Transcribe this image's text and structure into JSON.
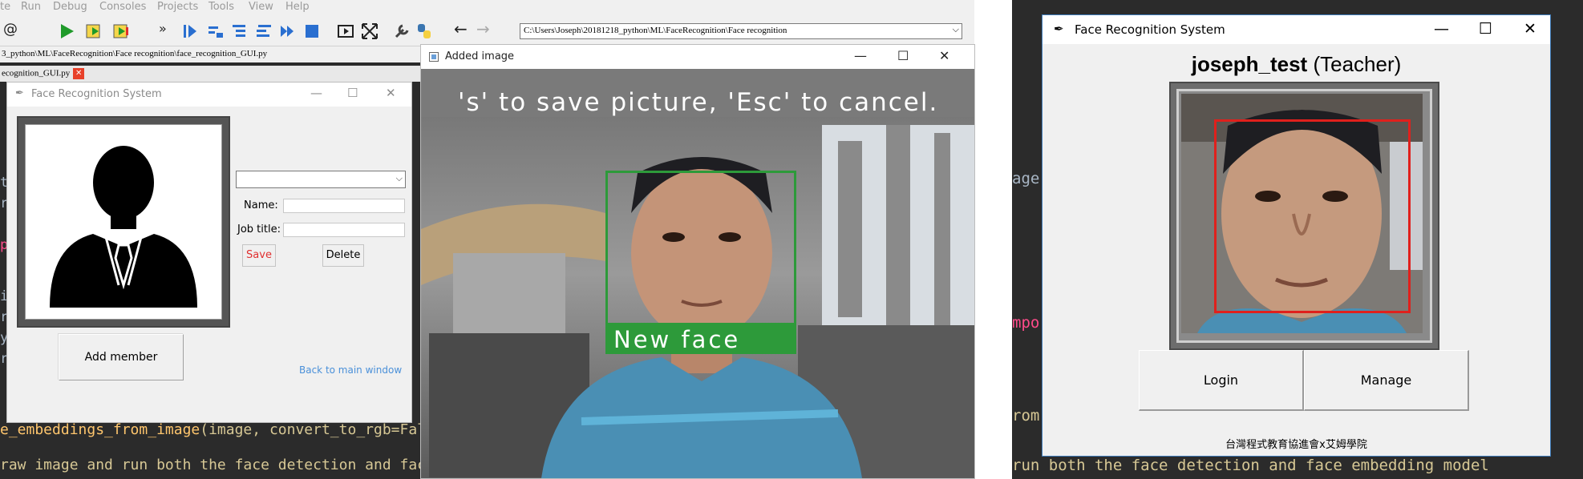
{
  "ide": {
    "menus": [
      "te",
      "Run",
      "Debug",
      "Consoles",
      "Projects",
      "Tools",
      "View",
      "Help"
    ],
    "path": "C:\\Users\\Joseph\\20181218_python\\ML\\FaceRecognition\\Face recognition",
    "file_path": "3_python\\ML\\FaceRecognition\\Face recognition\\face_recognition_GUI.py",
    "tab_label": "ecognition_GUI.py",
    "code_line_1_name": "e_embeddings_from_image",
    "code_line_1_rest": "(image, convert_to_rgb=Fals",
    "code_line_2": "raw image and run both the face detection and face",
    "right_code_line": "run both the face detection and face embedding model",
    "right_fragments": [
      "age",
      "mpo",
      "rom"
    ]
  },
  "small_window": {
    "title": "Face Recognition System",
    "name_label": "Name:",
    "job_label": "Job title:",
    "save_label": "Save",
    "delete_label": "Delete",
    "add_label": "Add member",
    "back_label": "Back to main window",
    "combo_value": "",
    "name_value": "",
    "job_value": ""
  },
  "camera_window": {
    "title": "Added image",
    "overlay_text": "'s' to save picture, 'Esc' to cancel.",
    "face_label": "New face",
    "box_color": "#2d9a3a"
  },
  "main_window": {
    "title": "Face Recognition System",
    "user_name": "joseph_test",
    "user_role": "(Teacher)",
    "login_label": "Login",
    "manage_label": "Manage",
    "footer": "台灣程式教育協進會x艾姆學院",
    "box_color": "#e0201c"
  }
}
